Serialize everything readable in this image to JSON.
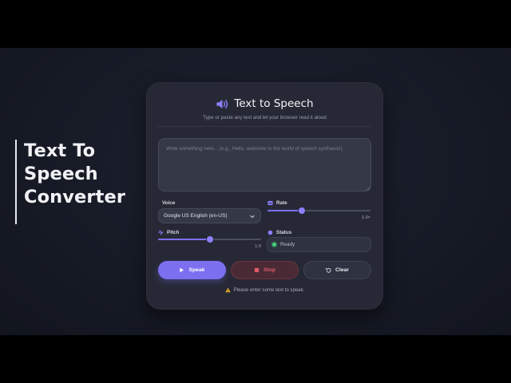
{
  "side_title": {
    "line1": "Text To",
    "line2": "Speech",
    "line3": "Converter"
  },
  "header": {
    "title": "Text to Speech",
    "subtitle": "Type or paste any text and let your browser read it aloud",
    "icon": "speaker-icon"
  },
  "input": {
    "value": "",
    "placeholder": "Write something here... (e.g., Hello, welcome to the world of speech synthesis!)"
  },
  "voice": {
    "label": "Voice",
    "selected": "Google US English (en-US)"
  },
  "rate": {
    "label": "Rate",
    "value": 1.0,
    "display": "1.0×",
    "min": 0.5,
    "max": 2.0
  },
  "pitch": {
    "label": "Pitch",
    "value": 1.0,
    "display": "1.0",
    "min": 0,
    "max": 2
  },
  "status": {
    "label": "Status",
    "text": "Ready",
    "color": "#43d17a"
  },
  "buttons": {
    "speak": "Speak",
    "stop": "Stop",
    "clear": "Clear"
  },
  "message": "Please enter some text to speak.",
  "colors": {
    "accent": "#7c6ff0",
    "danger": "#e05b6a",
    "success": "#43d17a",
    "warning": "#f0b429"
  }
}
